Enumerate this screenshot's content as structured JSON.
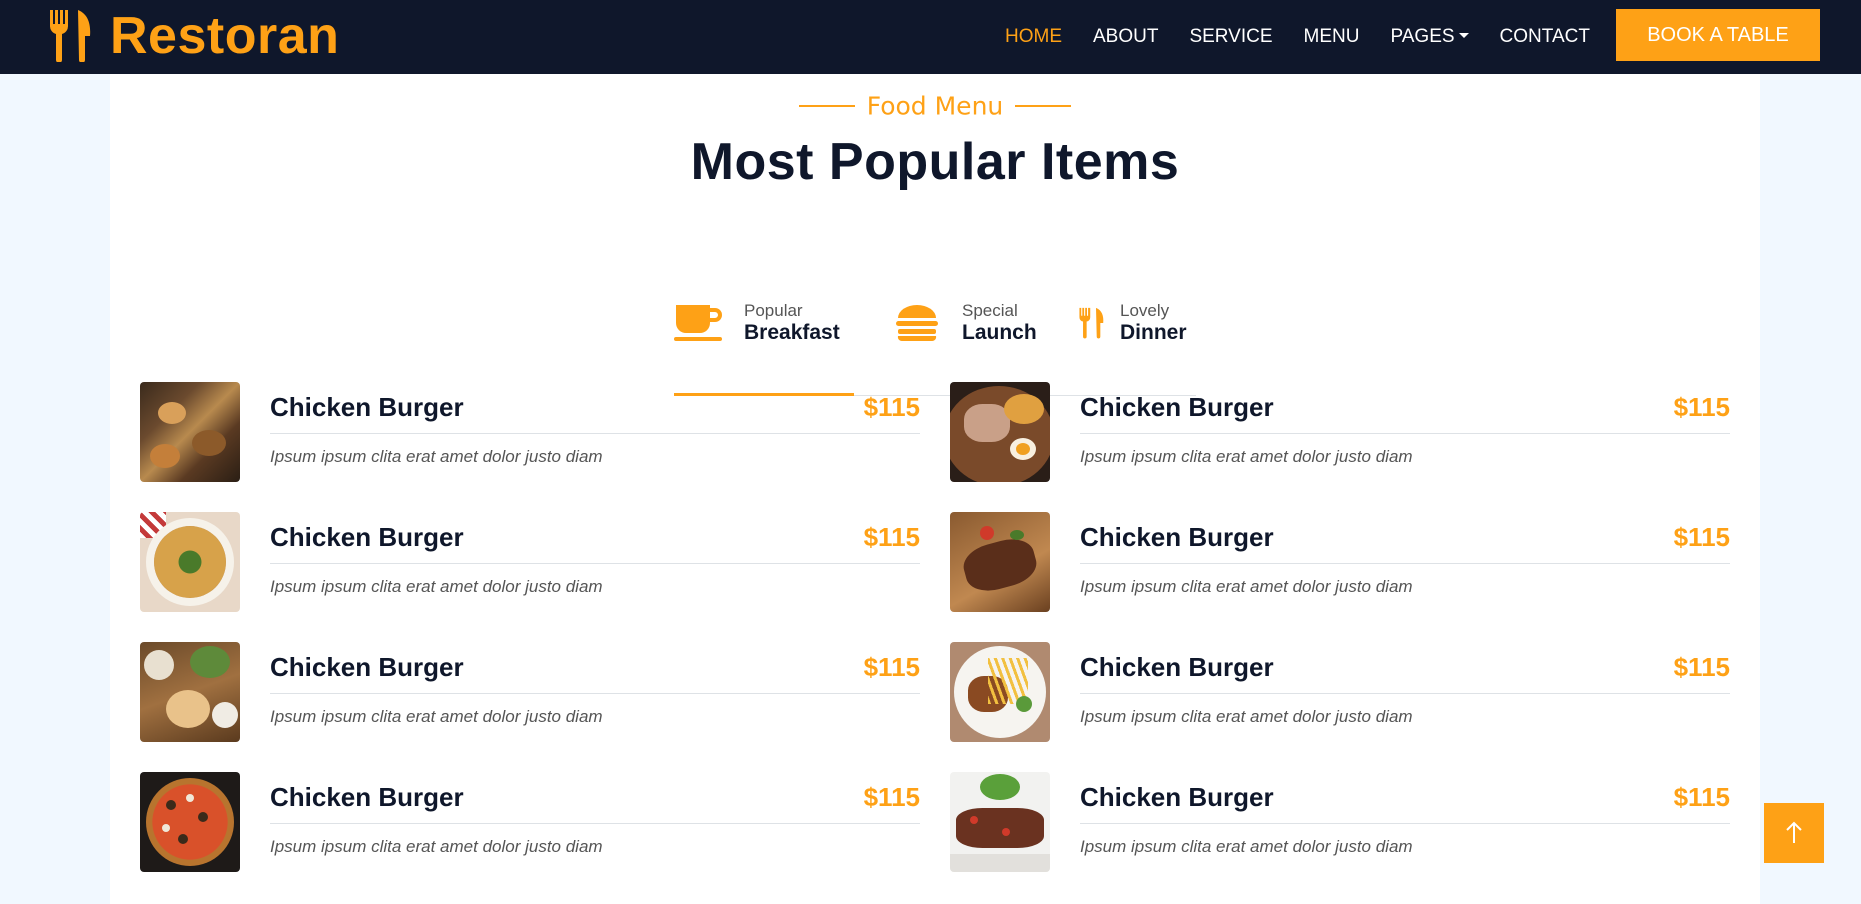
{
  "brand": {
    "name": "Restoran",
    "icon": "utensils-icon"
  },
  "nav": {
    "items": [
      {
        "label": "HOME",
        "active": true
      },
      {
        "label": "ABOUT"
      },
      {
        "label": "SERVICE"
      },
      {
        "label": "MENU"
      },
      {
        "label": "PAGES",
        "dropdown": true
      },
      {
        "label": "CONTACT"
      }
    ],
    "cta": "BOOK A TABLE"
  },
  "section": {
    "subtitle": "Food Menu",
    "title": "Most Popular Items"
  },
  "tabs": [
    {
      "small": "Popular",
      "big": "Breakfast",
      "icon": "coffee-icon",
      "active": true
    },
    {
      "small": "Special",
      "big": "Launch",
      "icon": "hamburger-icon",
      "active": false
    },
    {
      "small": "Lovely",
      "big": "Dinner",
      "icon": "utensils-icon",
      "active": false
    }
  ],
  "menu": {
    "left": [
      {
        "name": "Chicken Burger",
        "price": "$115",
        "desc": "Ipsum ipsum clita erat amet dolor justo diam",
        "image": "food-platter"
      },
      {
        "name": "Chicken Burger",
        "price": "$115",
        "desc": "Ipsum ipsum clita erat amet dolor justo diam",
        "image": "pizza-greens"
      },
      {
        "name": "Chicken Burger",
        "price": "$115",
        "desc": "Ipsum ipsum clita erat amet dolor justo diam",
        "image": "table-spread"
      },
      {
        "name": "Chicken Burger",
        "price": "$115",
        "desc": "Ipsum ipsum clita erat amet dolor justo diam",
        "image": "pepperoni-pizza"
      }
    ],
    "right": [
      {
        "name": "Chicken Burger",
        "price": "$115",
        "desc": "Ipsum ipsum clita erat amet dolor justo diam",
        "image": "ramen-bowl"
      },
      {
        "name": "Chicken Burger",
        "price": "$115",
        "desc": "Ipsum ipsum clita erat amet dolor justo diam",
        "image": "grilled-steak"
      },
      {
        "name": "Chicken Burger",
        "price": "$115",
        "desc": "Ipsum ipsum clita erat amet dolor justo diam",
        "image": "steak-fries"
      },
      {
        "name": "Chicken Burger",
        "price": "$115",
        "desc": "Ipsum ipsum clita erat amet dolor justo diam",
        "image": "beef-salad"
      }
    ]
  },
  "back_to_top": {
    "icon": "arrow-up-icon"
  },
  "colors": {
    "primary": "#fea116",
    "dark": "#0f172b",
    "light": "#f1f8ff"
  }
}
